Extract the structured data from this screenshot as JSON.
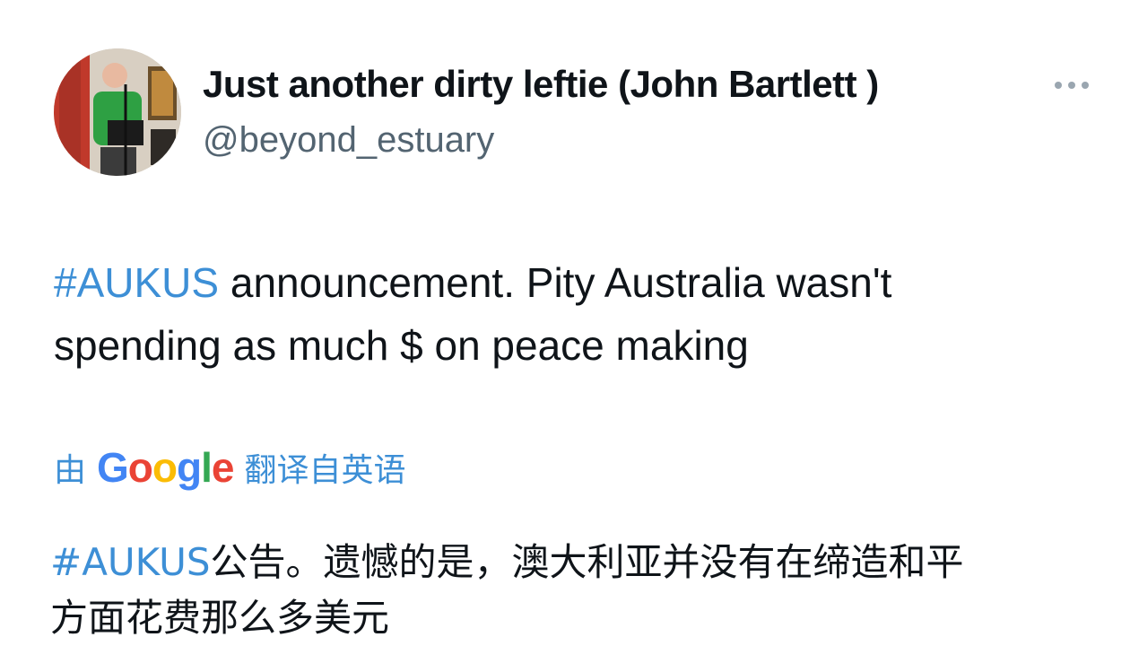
{
  "author": {
    "display_name": "Just another dirty leftie (John Bartlett )",
    "handle": "@beyond_estuary",
    "avatar_icon": "profile-photo"
  },
  "menu": {
    "icon": "more-dots-icon"
  },
  "tweet": {
    "hashtag": "#AUKUS",
    "text_line1_rest": " announcement. Pity Australia wasn't",
    "text_line2": "spending as much $ on peace making"
  },
  "translation": {
    "prefix": "由",
    "provider": "Google",
    "suffix": "翻译自英语",
    "hashtag": "#AUKUS",
    "text_rest_line1": "公告。遗憾的是，澳大利亚并没有在缔造和平",
    "text_line2": "方面花费那么多美元"
  },
  "colors": {
    "hashtag": "#3d8fd6",
    "handle": "#536471",
    "text": "#0f1419"
  }
}
